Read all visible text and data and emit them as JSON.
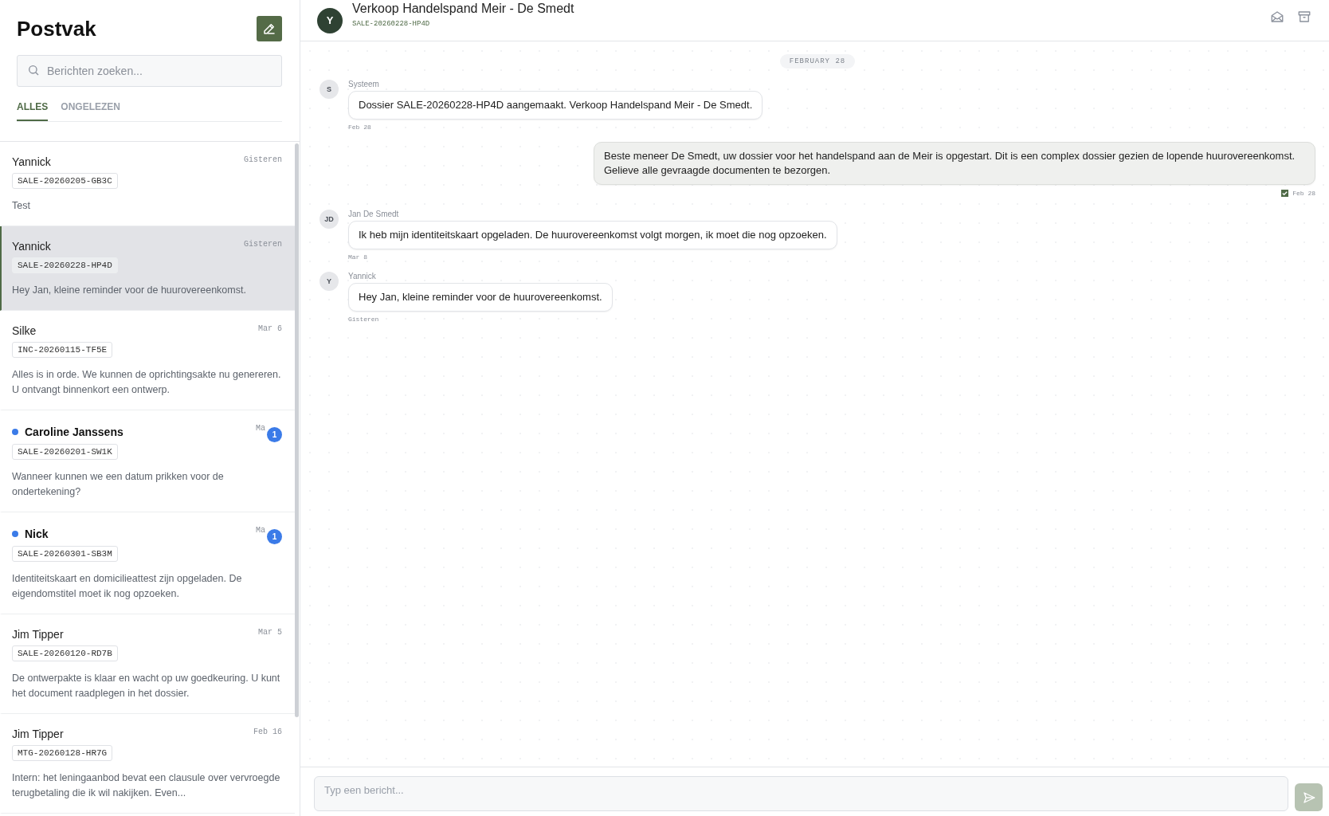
{
  "sidebar": {
    "title": "Postvak",
    "search": {
      "placeholder": "Berichten zoeken..."
    },
    "tabs": [
      {
        "label": "ALLES",
        "selected": true
      },
      {
        "label": "ONGELEZEN",
        "selected": false
      }
    ],
    "conversations": [
      {
        "name": "Yannick",
        "date": "Gisteren",
        "reference": "SALE-20260205-GB3C",
        "preview": "Test",
        "unread": false,
        "selected": false
      },
      {
        "name": "Yannick",
        "date": "Gisteren",
        "reference": "SALE-20260228-HP4D",
        "preview": "Hey Jan, kleine reminder voor de huurovereenkomst.",
        "unread": false,
        "selected": true
      },
      {
        "name": "Silke",
        "date": "Mar 6",
        "reference": "INC-20260115-TF5E",
        "preview": "Alles is in orde. We kunnen de oprichtingsakte nu genereren. U ontvangt binnenkort een ontwerp.",
        "unread": false,
        "selected": false
      },
      {
        "name": "Caroline Janssens",
        "date": "Ma",
        "reference": "SALE-20260201-SW1K",
        "preview": "Wanneer kunnen we een datum prikken voor de ondertekening?",
        "unread": true,
        "badge": "1",
        "selected": false
      },
      {
        "name": "Nick",
        "date": "Ma",
        "reference": "SALE-20260301-SB3M",
        "preview": "Identiteitskaart en domicilieattest zijn opgeladen. De eigendomstitel moet ik nog opzoeken.",
        "unread": true,
        "badge": "1",
        "selected": false
      },
      {
        "name": "Jim Tipper",
        "date": "Mar 5",
        "reference": "SALE-20260120-RD7B",
        "preview": "De ontwerpakte is klaar en wacht op uw goedkeuring. U kunt het document raadplegen in het dossier.",
        "unread": false,
        "selected": false
      },
      {
        "name": "Jim Tipper",
        "date": "Feb 16",
        "reference": "MTG-20260128-HR7G",
        "preview": "Intern: het leningaanbod bevat een clausule over vervroegde terugbetaling die ik wil nakijken. Even...",
        "unread": false,
        "selected": false
      }
    ]
  },
  "conversation": {
    "avatar": "Y",
    "title": "Verkoop Handelspand Meir - De Smedt",
    "reference": "SALE-20260228-HP4D",
    "date_divider": "FEBRUARY 28",
    "messages": [
      {
        "kind": "incoming",
        "avatar": "S",
        "sender": "Systeem",
        "text": "Dossier SALE-20260228-HP4D aangemaakt. Verkoop Handelspand Meir - De Smedt.",
        "time": "Feb 28"
      },
      {
        "kind": "outgoing",
        "text": "Beste meneer De Smedt, uw dossier voor het handelspand aan de Meir is opgestart. Dit is een complex dossier gezien de lopende huurovereenkomst. Gelieve alle gevraagde documenten te bezorgen.",
        "time": "Feb 28",
        "read": true
      },
      {
        "kind": "incoming",
        "avatar": "JD",
        "sender": "Jan De Smedt",
        "text": "Ik heb mijn identiteitskaart opgeladen. De huurovereenkomst volgt morgen, ik moet die nog opzoeken.",
        "time": "Mar 8"
      },
      {
        "kind": "incoming",
        "avatar": "Y",
        "sender": "Yannick",
        "text": "Hey Jan, kleine reminder voor de huurovereenkomst.",
        "time": "Gisteren"
      }
    ],
    "composer": {
      "placeholder": "Typ een bericht..."
    }
  }
}
